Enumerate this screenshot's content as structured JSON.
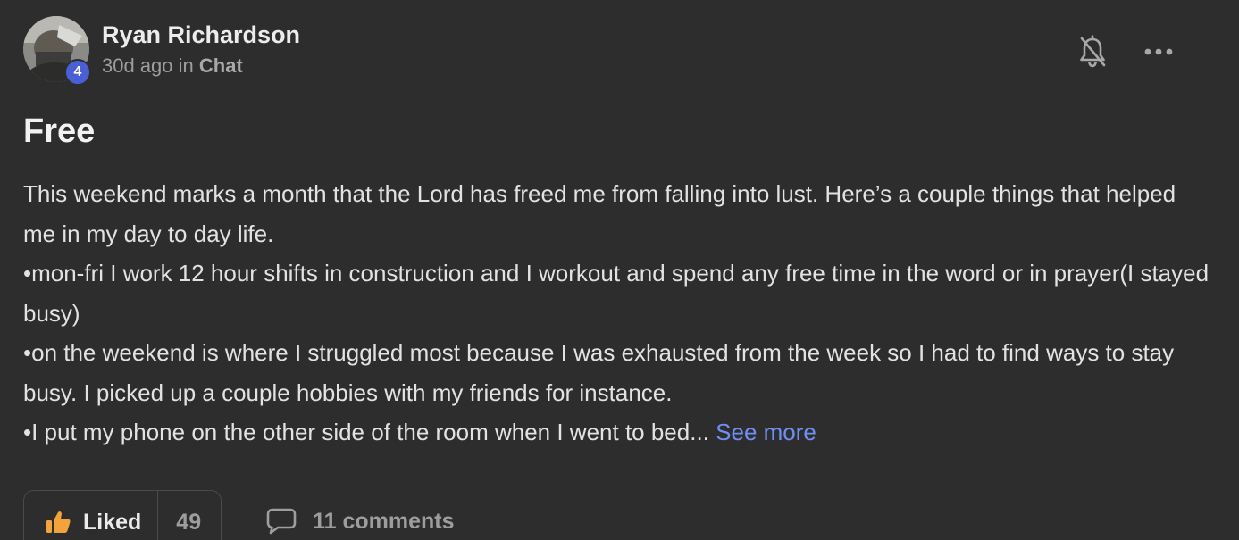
{
  "post": {
    "author": "Ryan Richardson",
    "level": "4",
    "time_prefix": "30d ago in",
    "channel": "Chat",
    "title": "Free",
    "body_lines": [
      "This weekend marks a month that the Lord has freed me from falling into lust. Here’s a couple things that helped me in my day to day life.",
      "•mon-fri I work 12 hour shifts in construction and I workout and spend any free time in the word or in prayer(I stayed busy)",
      "•on the weekend is where I struggled most because I was exhausted from the week so I had to find ways to stay busy. I picked up a couple hobbies with my friends for instance.",
      "•I put my phone on the other side of the room when I went to bed..."
    ],
    "see_more": "See more"
  },
  "footer": {
    "like_label": "Liked",
    "like_count": "49",
    "comments_label": "11 comments"
  },
  "icons": {
    "notify": "bell-off-icon",
    "more": "more-horizontal-icon",
    "like": "thumbs-up-icon",
    "comment": "comment-icon"
  },
  "colors": {
    "background": "#2d2d2e",
    "link": "#6f8ff3",
    "badge": "#4a5fd6",
    "like_icon": "#f2a33a"
  }
}
